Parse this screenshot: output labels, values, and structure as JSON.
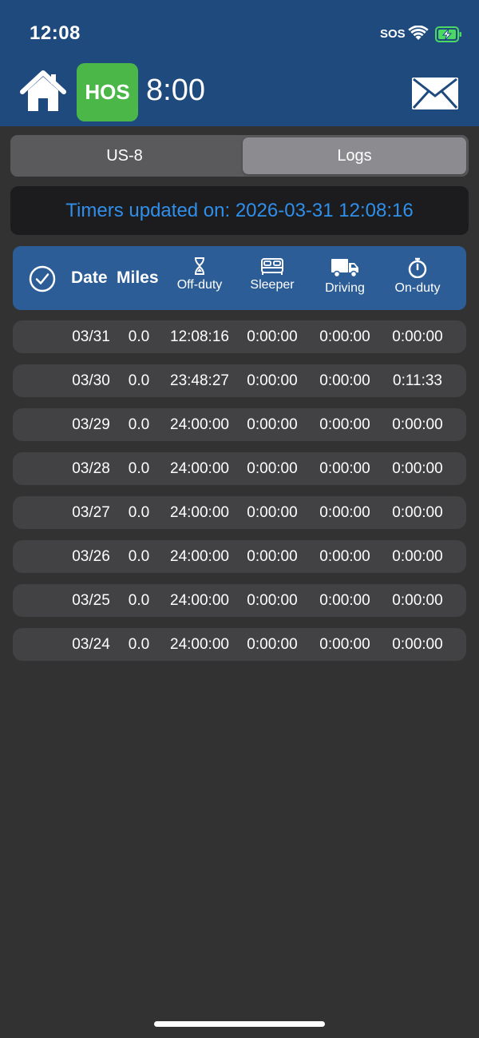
{
  "status_bar": {
    "time": "12:08",
    "sos": "SOS",
    "wifi_icon": "wifi-icon",
    "battery_icon": "battery-charging-icon"
  },
  "header": {
    "home_icon": "home-icon",
    "hos_label": "HOS",
    "hos_time": "8:00",
    "mail_icon": "mail-icon"
  },
  "segments": {
    "left": "US-8",
    "right": "Logs",
    "selected": "Logs"
  },
  "banner": {
    "text": "Timers updated on: 2026-03-31 12:08:16"
  },
  "table": {
    "headers": {
      "date": "Date",
      "miles": "Miles",
      "off_duty": "Off-duty",
      "sleeper": "Sleeper",
      "driving": "Driving",
      "on_duty": "On-duty"
    },
    "rows": [
      {
        "date": "03/31",
        "miles": "0.0",
        "off": "12:08:16",
        "sleeper": "0:00:00",
        "driving": "0:00:00",
        "on": "0:00:00"
      },
      {
        "date": "03/30",
        "miles": "0.0",
        "off": "23:48:27",
        "sleeper": "0:00:00",
        "driving": "0:00:00",
        "on": "0:11:33"
      },
      {
        "date": "03/29",
        "miles": "0.0",
        "off": "24:00:00",
        "sleeper": "0:00:00",
        "driving": "0:00:00",
        "on": "0:00:00"
      },
      {
        "date": "03/28",
        "miles": "0.0",
        "off": "24:00:00",
        "sleeper": "0:00:00",
        "driving": "0:00:00",
        "on": "0:00:00"
      },
      {
        "date": "03/27",
        "miles": "0.0",
        "off": "24:00:00",
        "sleeper": "0:00:00",
        "driving": "0:00:00",
        "on": "0:00:00"
      },
      {
        "date": "03/26",
        "miles": "0.0",
        "off": "24:00:00",
        "sleeper": "0:00:00",
        "driving": "0:00:00",
        "on": "0:00:00"
      },
      {
        "date": "03/25",
        "miles": "0.0",
        "off": "24:00:00",
        "sleeper": "0:00:00",
        "driving": "0:00:00",
        "on": "0:00:00"
      },
      {
        "date": "03/24",
        "miles": "0.0",
        "off": "24:00:00",
        "sleeper": "0:00:00",
        "driving": "0:00:00",
        "on": "0:00:00"
      }
    ]
  },
  "colors": {
    "header_bg": "#1e4a7e",
    "hos_green": "#4bb748",
    "banner_text": "#2f8fea",
    "table_header_bg": "#2c5d96",
    "body_bg": "#323232"
  }
}
